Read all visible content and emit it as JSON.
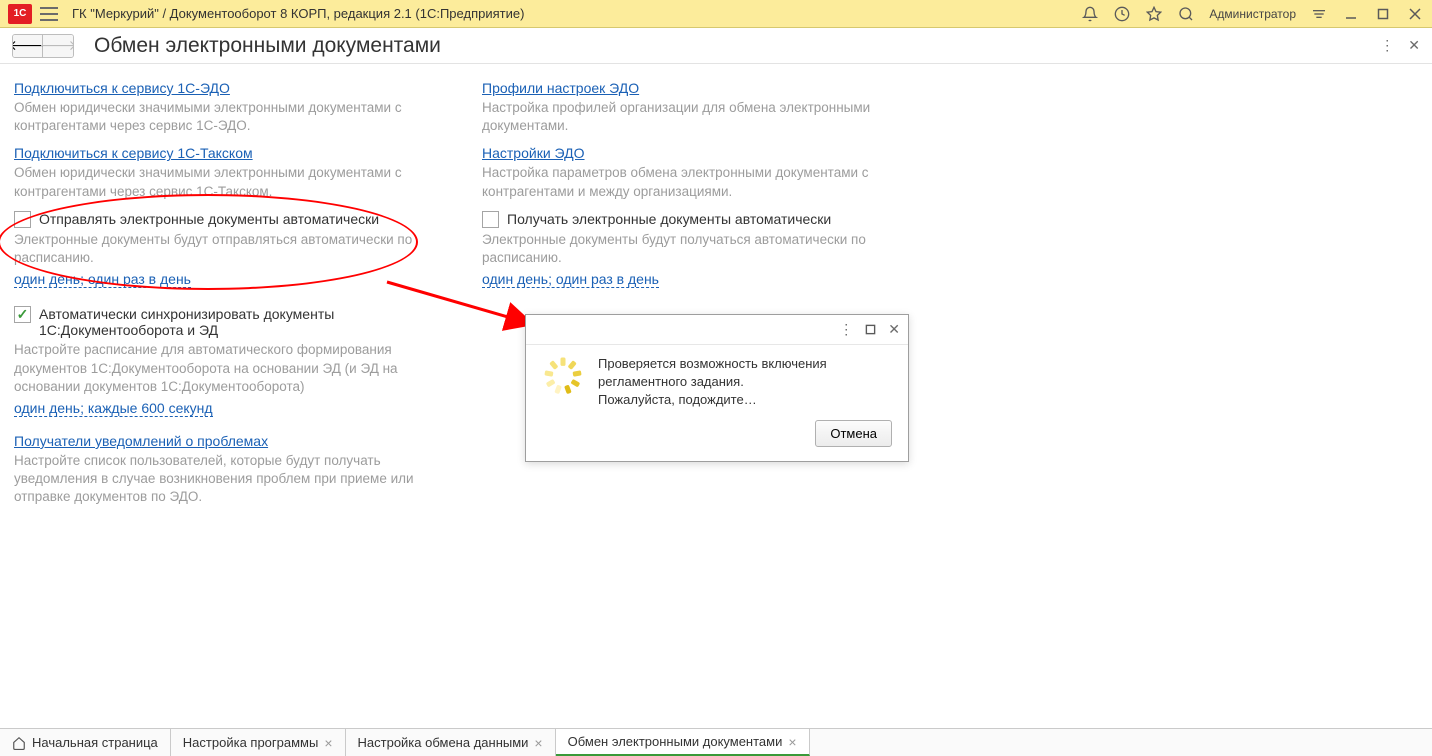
{
  "titlebar": {
    "title": "ГК \"Меркурий\" / Документооборот 8 КОРП, редакция 2.1  (1С:Предприятие)",
    "user": "Администратор"
  },
  "page": {
    "title": "Обмен электронными документами"
  },
  "left": {
    "link_edo": "Подключиться к сервису 1С-ЭДО",
    "desc_edo": "Обмен юридически значимыми электронными документами с контрагентами через сервис 1С-ЭДО.",
    "link_taxcom": "Подключиться к сервису 1С-Такском",
    "desc_taxcom": "Обмен юридически значимыми электронными документами с контрагентами через сервис 1С-Такском.",
    "chk_auto_send": "Отправлять электронные документы автоматически",
    "desc_auto_send": "Электронные документы будут отправляться автоматически по расписанию.",
    "sched_send": "один день; один раз в день",
    "chk_auto_sync": "Автоматически синхронизировать документы 1С:Документооборота и ЭД",
    "desc_auto_sync": "Настройте расписание для автоматического формирования документов 1С:Документооборота на основании ЭД (и ЭД на основании документов 1С:Документооборота)",
    "sched_sync": "один день; каждые 600 секунд",
    "link_recipients": "Получатели уведомлений о проблемах",
    "desc_recipients": "Настройте список пользователей, которые будут получать уведомления в случае возникновения проблем при приеме или отправке документов по ЭДО."
  },
  "right": {
    "link_profiles": "Профили настроек ЭДО",
    "desc_profiles": "Настройка профилей организации для обмена электронными документами.",
    "link_settings": "Настройки ЭДО",
    "desc_settings": "Настройка параметров обмена электронными документами с контрагентами и между организациями.",
    "chk_auto_recv": "Получать электронные документы автоматически",
    "desc_auto_recv": "Электронные документы будут получаться автоматически по расписанию.",
    "sched_recv": "один день; один раз в день"
  },
  "dialog": {
    "line1": "Проверяется возможность включения регламентного задания.",
    "line2": "Пожалуйста, подождите…",
    "cancel": "Отмена"
  },
  "tabs": {
    "home": "Начальная страница",
    "t1": "Настройка программы",
    "t2": "Настройка обмена данными",
    "t3": "Обмен электронными документами"
  }
}
